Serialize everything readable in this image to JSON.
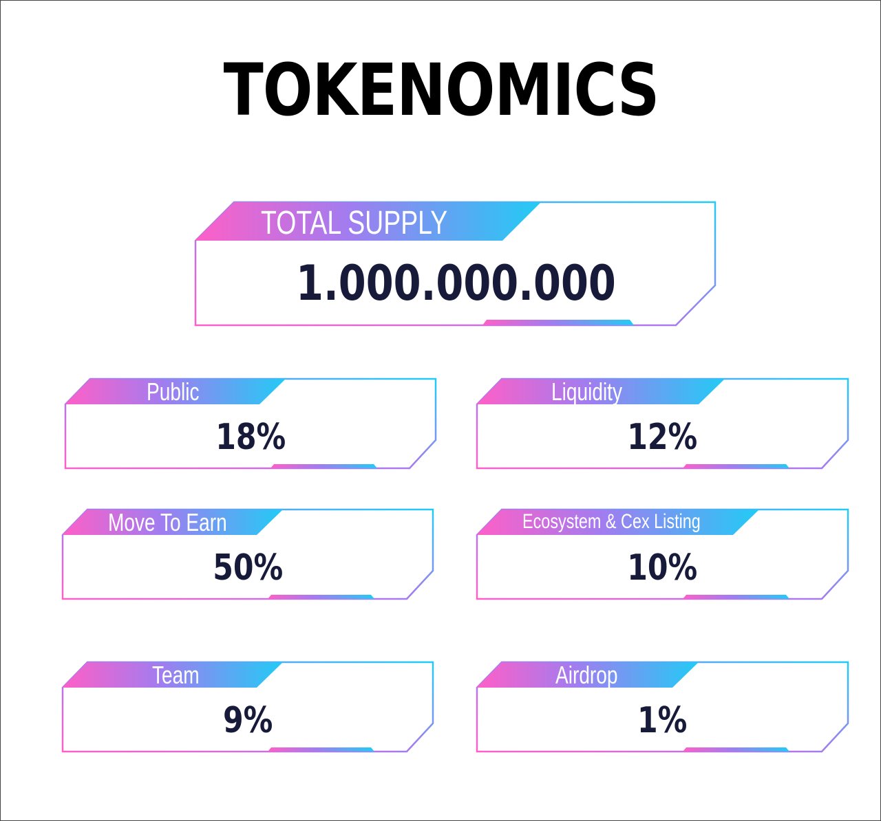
{
  "title": "TOKENOMICS",
  "colors": {
    "pink": "#ff5fc7",
    "purple": "#a07df0",
    "cyan": "#22cbf5",
    "value_text": "#181a3a"
  },
  "total_supply": {
    "label": "TOTAL SUPPLY",
    "value": "1.000.000.000"
  },
  "allocations": [
    {
      "label": "Public",
      "value": "18%"
    },
    {
      "label": "Liquidity",
      "value": "12%"
    },
    {
      "label": "Move To Earn",
      "value": "50%"
    },
    {
      "label": "Ecosystem & Cex Listing",
      "value": "10%"
    },
    {
      "label": "Team",
      "value": "9%"
    },
    {
      "label": "Airdrop",
      "value": "1%"
    }
  ]
}
